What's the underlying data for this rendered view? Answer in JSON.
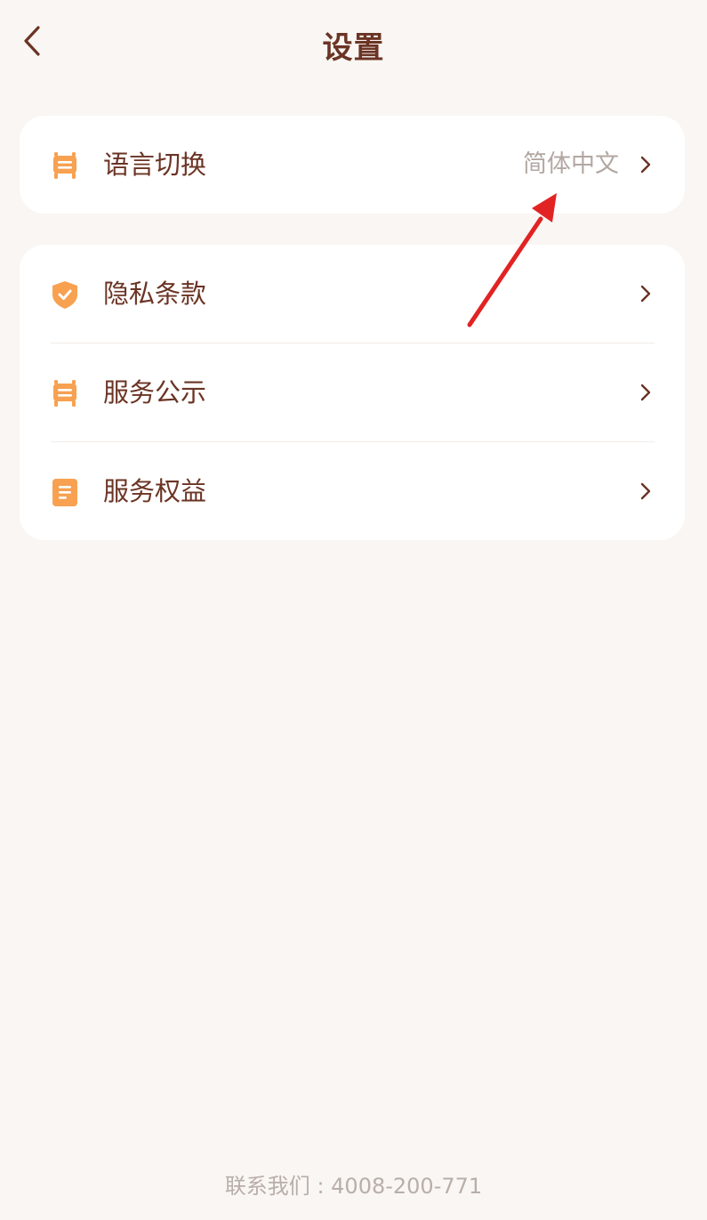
{
  "header": {
    "title": "设置",
    "back_icon": "chevron-left-icon"
  },
  "language_card": {
    "label": "语言切换",
    "value": "简体中文",
    "icon": "notice-board-icon"
  },
  "menu": {
    "items": [
      {
        "label": "隐私条款",
        "icon": "shield-check-icon"
      },
      {
        "label": "服务公示",
        "icon": "notice-board-icon"
      },
      {
        "label": "服务权益",
        "icon": "document-icon"
      }
    ]
  },
  "footer": {
    "contact": "联系我们 : 4008-200-771"
  },
  "colors": {
    "background": "#f9f6f3",
    "card": "#ffffff",
    "primary_text": "#6b3424",
    "secondary_text": "#b3a7a2",
    "icon_accent": "#f7a151",
    "annotation_arrow": "#e22323"
  }
}
